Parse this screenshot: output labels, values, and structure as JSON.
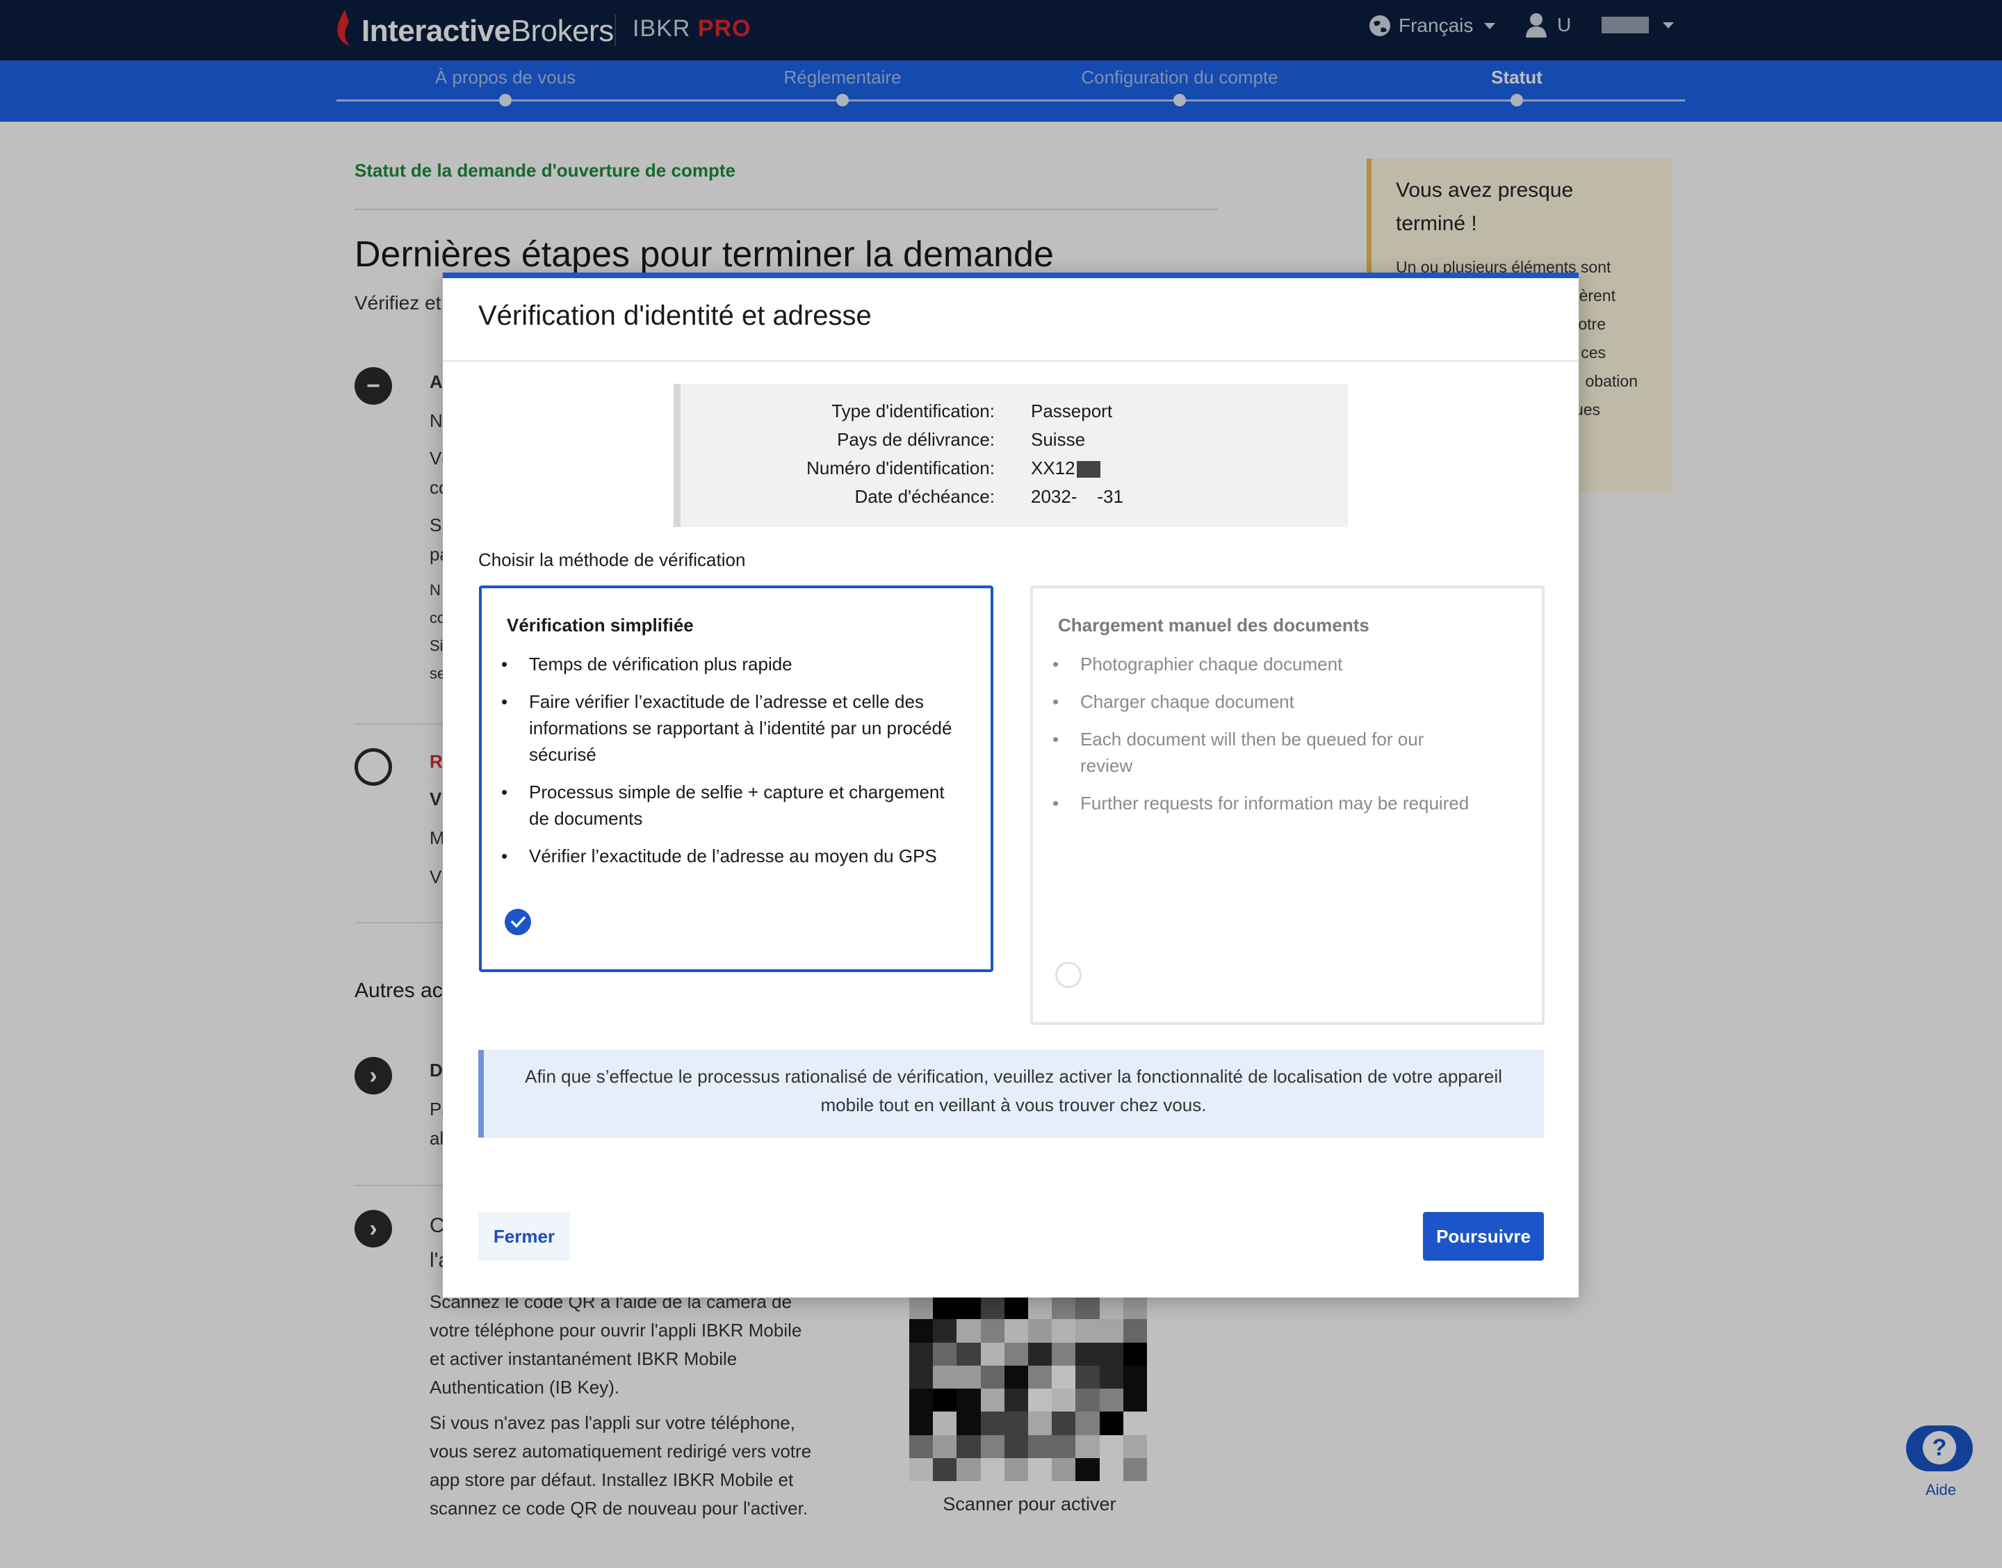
{
  "header": {
    "brand_bold": "Interactive",
    "brand_light": "Brokers",
    "product": "IBKR",
    "product_tier": "PRO",
    "language": "Français",
    "user_initial": "U"
  },
  "steps": [
    {
      "label": "À propos de vous",
      "active": false
    },
    {
      "label": "Réglementaire",
      "active": false
    },
    {
      "label": "Configuration du compte",
      "active": false
    },
    {
      "label": "Statut",
      "active": true
    }
  ],
  "background": {
    "status_title": "Statut de la demande d'ouverture de compte",
    "heading": "Dernières étapes pour terminer la demande",
    "subheading": "Vérifiez et",
    "task_fragments": [
      "A",
      "N",
      "Vé",
      "co",
      "Si",
      "pa",
      "N",
      "co",
      "Si",
      "se"
    ],
    "task2_fragments": [
      "R",
      "V",
      "M",
      "V"
    ],
    "others_heading": "Autres ac",
    "action1_fragments": [
      "D",
      "Pa",
      "al"
    ],
    "action2_fragments": [
      "C",
      "l'a"
    ],
    "qr_text_1": "Scannez le code QR à l'aide de la caméra de votre téléphone pour ouvrir l'appli IBKR Mobile et activer instantanément IBKR Mobile Authentication (IB Key).",
    "qr_text_2": "Si vous n'avez pas l'appli sur votre téléphone, vous serez automatiquement redirigé vers votre app store par défaut. Installez IBKR Mobile et scannez ce code QR de nouveau pour l'activer.",
    "qr_label": "Scanner pour activer",
    "side_heading": "Vous avez presque terminé !",
    "side_lines": [
      "Un ou plusieurs éléments sont",
      "ièrent",
      "votre",
      "ces",
      "obation",
      "",
      "ues"
    ],
    "help_label": "Aide"
  },
  "modal": {
    "title": "Vérification d'identité et adresse",
    "id_rows": [
      {
        "label": "Type d'identification:",
        "value": "Passeport"
      },
      {
        "label": "Pays de délivrance:",
        "value": "Suisse"
      },
      {
        "label": "Numéro d'identification:",
        "value": "XX12"
      },
      {
        "label": "Date d'échéance:",
        "value": "2032-    -31"
      }
    ],
    "choose_label": "Choisir la méthode de vérification",
    "option_simplified": {
      "title": "Vérification simplifiée",
      "selected": true,
      "bullets": [
        "Temps de vérification plus rapide",
        "Faire vérifier l’exactitude de l’adresse et celle des informations se rapportant à l’identité par un procédé sécurisé",
        "Processus simple de selfie + capture et chargement de documents",
        "Vérifier l’exactitude de l’adresse au moyen du GPS"
      ]
    },
    "option_manual": {
      "title": "Chargement manuel des documents",
      "selected": false,
      "bullets": [
        "Photographier chaque document",
        "Charger chaque document",
        "Each document will then be queued for our review",
        "Further requests for information may be required"
      ]
    },
    "notice": "Afin que s’effectue le processus rationalisé de vérification, veuillez activer la fonctionnalité de localisation de votre appareil mobile tout en veillant à vous trouver chez vous.",
    "close_label": "Fermer",
    "continue_label": "Poursuivre"
  },
  "colors": {
    "header_bg": "#0b1f3f",
    "steps_bg": "#1d63e8",
    "accent": "#1b55c9",
    "brand_red": "#e3262b",
    "status_green": "#1c8c3a"
  },
  "icons": [
    "globe-icon",
    "user-icon",
    "chevron-down-icon",
    "minus-icon",
    "chevron-right-icon",
    "check-icon",
    "help-icon"
  ]
}
